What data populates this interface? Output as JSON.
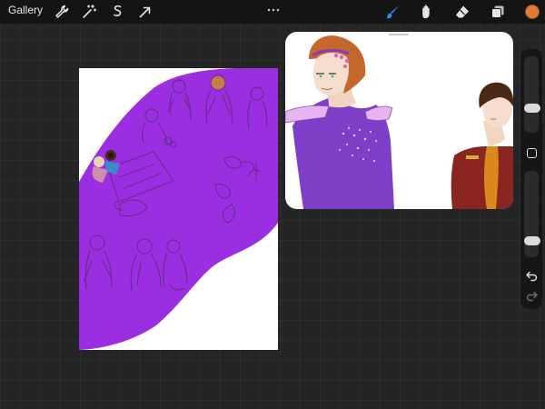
{
  "topbar": {
    "gallery_label": "Gallery",
    "left_tools": [
      {
        "name": "wrench-icon"
      },
      {
        "name": "magic-wand-icon"
      },
      {
        "name": "selection-icon"
      },
      {
        "name": "transform-arrow-icon"
      }
    ],
    "right_tools": [
      {
        "name": "brush-icon",
        "active": true
      },
      {
        "name": "smudge-icon"
      },
      {
        "name": "eraser-icon"
      },
      {
        "name": "layers-icon"
      }
    ],
    "current_color": "#e07a35"
  },
  "sidebar": {
    "brush_size_level": 0.3,
    "opacity_level": 0.15,
    "icons": [
      "undo-icon",
      "redo-icon"
    ]
  },
  "colors": {
    "accent": "#2e8fff",
    "canvas_fill": "#9b2ee0",
    "reference_robe": "#7e3ec8",
    "reference_hair": "#c4672c",
    "reference_coat": "#8b2520"
  }
}
